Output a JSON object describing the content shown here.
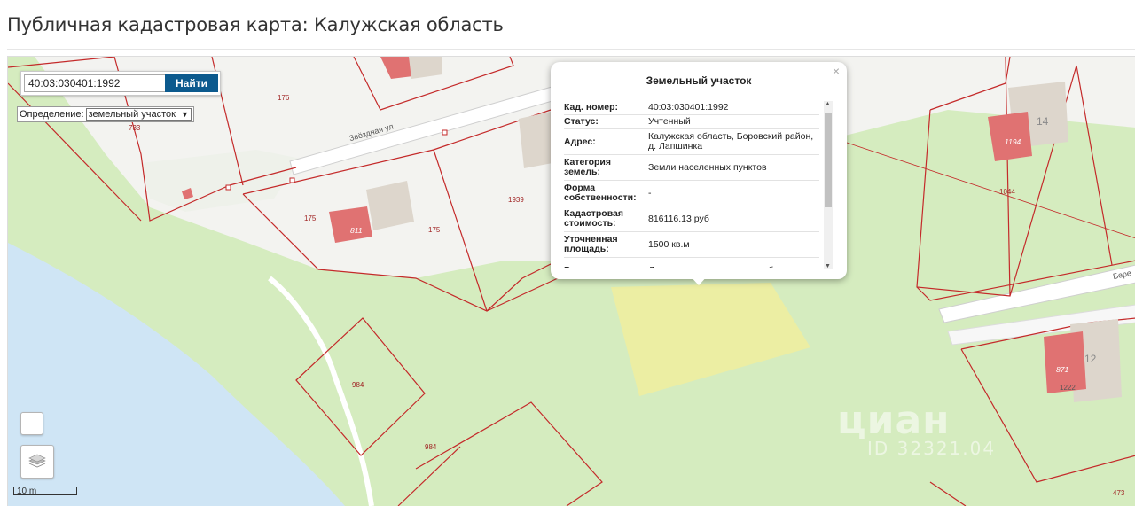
{
  "page_title": "Публичная кадастровая карта: Калужская область",
  "search": {
    "value": "40:03:030401:1992",
    "button": "Найти"
  },
  "definition": {
    "label": "Определение:",
    "selected": "земельный участок"
  },
  "popup": {
    "title": "Земельный участок",
    "close": "×",
    "rows": [
      {
        "key": "Кад. номер:",
        "value": "40:03:030401:1992"
      },
      {
        "key": "Статус:",
        "value": "Учтенный"
      },
      {
        "key": "Адрес:",
        "value": "Калужская область, Боровский район, д. Лапшинка"
      },
      {
        "key": "Категория земель:",
        "value": "Земли населенных пунктов"
      },
      {
        "key": "Форма собственности:",
        "value": "-"
      },
      {
        "key": "Кадастровая стоимость:",
        "value": "816116.13 руб"
      },
      {
        "key": "Уточненная площадь:",
        "value": "1500 кв.м"
      },
      {
        "key": "Разрешенное",
        "value": "Для ведения личного подсобного"
      }
    ]
  },
  "map_labels": {
    "p176": "176",
    "p733": "733",
    "p175a": "175",
    "p175b": "175",
    "p1939": "1939",
    "p1044": "1044",
    "p984a": "984",
    "p984b": "984",
    "p473": "473",
    "p1222": "1222",
    "i811": "811",
    "i1194": "1194",
    "i871": "871",
    "h14": "14",
    "h12": "12",
    "street_zvezd": "Звёздная ул.",
    "street_ber": "Бере"
  },
  "scale": {
    "label": "10 m"
  },
  "watermark": {
    "brand": "циан",
    "id": "ID 32321.04"
  },
  "colors": {
    "land_green": "#d5ecbf",
    "water": "#cfe5f5",
    "parcel_line": "#c42a2a",
    "selected_parcel": "#eeeea0",
    "building_pink": "#e07272",
    "button_blue": "#0c5a8e"
  }
}
